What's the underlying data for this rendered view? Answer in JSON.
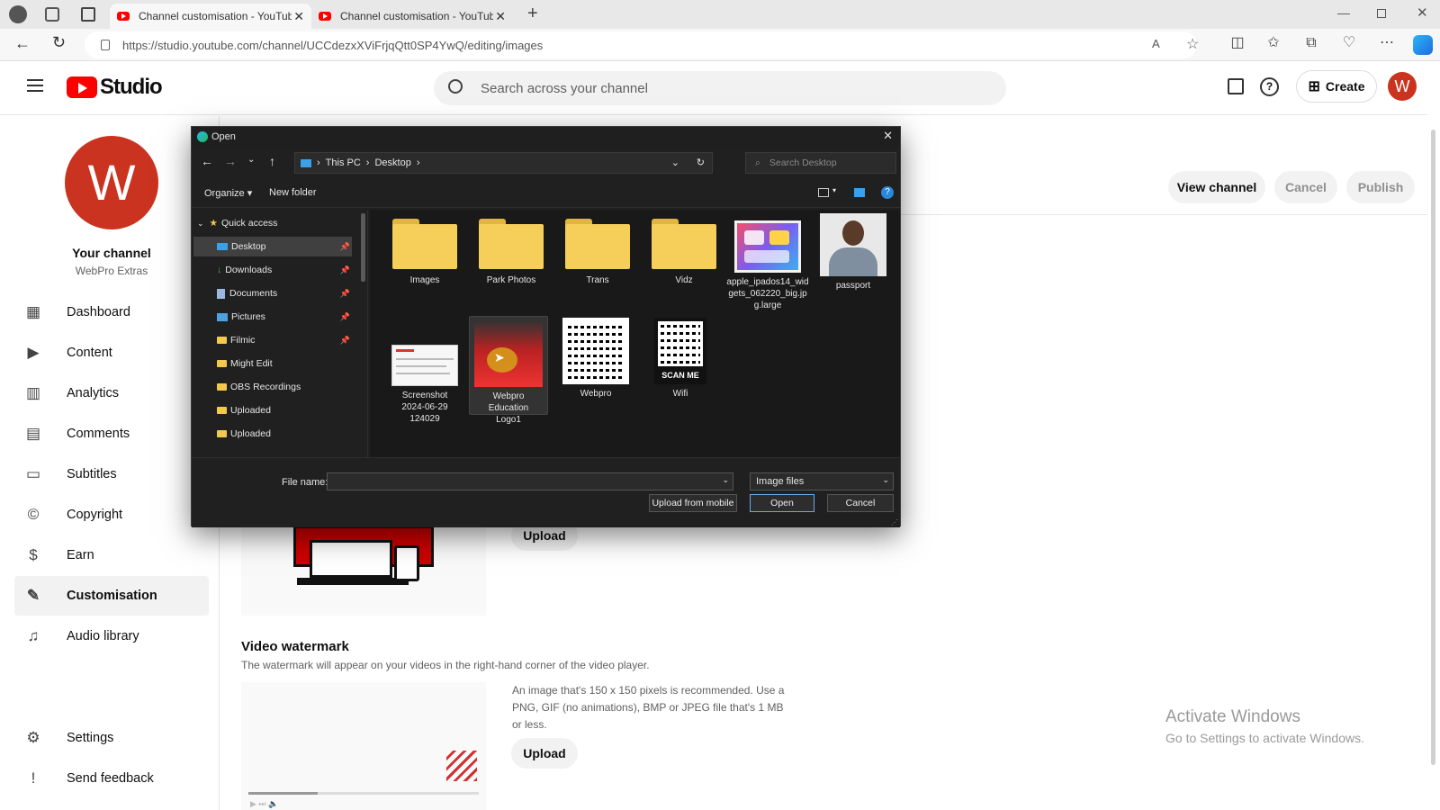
{
  "browser": {
    "tabs": [
      {
        "label": "Channel customisation - YouTube"
      },
      {
        "label": "Channel customisation - YouTube"
      }
    ],
    "url": "https://studio.youtube.com/channel/UCCdezxXViFrjqQtt0SP4YwQ/editing/images"
  },
  "header": {
    "logo_text": "Studio",
    "search_placeholder": "Search across your channel",
    "create_label": "Create",
    "avatar_letter": "W"
  },
  "sidebar": {
    "avatar_letter": "W",
    "channel_title": "Your channel",
    "channel_name": "WebPro Extras",
    "items": [
      {
        "label": "Dashboard",
        "icon": "dashboard-icon"
      },
      {
        "label": "Content",
        "icon": "content-icon"
      },
      {
        "label": "Analytics",
        "icon": "analytics-icon"
      },
      {
        "label": "Comments",
        "icon": "comments-icon"
      },
      {
        "label": "Subtitles",
        "icon": "subtitles-icon"
      },
      {
        "label": "Copyright",
        "icon": "copyright-icon"
      },
      {
        "label": "Earn",
        "icon": "earn-icon"
      },
      {
        "label": "Customisation",
        "icon": "customisation-icon"
      },
      {
        "label": "Audio library",
        "icon": "audio-library-icon"
      }
    ],
    "settings_label": "Settings",
    "feedback_label": "Send feedback"
  },
  "page": {
    "view_channel": "View channel",
    "cancel": "Cancel",
    "publish": "Publish",
    "upload_top": "Upload",
    "watermark_title": "Video watermark",
    "watermark_desc": "The watermark will appear on your videos in the right-hand corner of the video player.",
    "watermark_hint": "An image that's 150 x 150 pixels is recommended. Use a PNG, GIF (no animations), BMP or JPEG file that's 1 MB or less.",
    "upload_bottom": "Upload",
    "activate_title": "Activate Windows",
    "activate_sub": "Go to Settings to activate Windows."
  },
  "dialog": {
    "title": "Open",
    "crumb": [
      "This PC",
      "Desktop"
    ],
    "search_placeholder": "Search Desktop",
    "organize": "Organize",
    "new_folder": "New folder",
    "quick_access": "Quick access",
    "tree": [
      {
        "label": "Desktop",
        "pinned": true
      },
      {
        "label": "Downloads",
        "pinned": true
      },
      {
        "label": "Documents",
        "pinned": true
      },
      {
        "label": "Pictures",
        "pinned": true
      },
      {
        "label": "Filmic",
        "pinned": true
      },
      {
        "label": "Might Edit",
        "pinned": false
      },
      {
        "label": "OBS Recordings",
        "pinned": false
      },
      {
        "label": "Uploaded",
        "pinned": false
      },
      {
        "label": "Uploaded",
        "pinned": false
      }
    ],
    "files": [
      {
        "name": "Images",
        "kind": "folder"
      },
      {
        "name": "Park Photos",
        "kind": "folder"
      },
      {
        "name": "Trans",
        "kind": "folder"
      },
      {
        "name": "Vidz",
        "kind": "folder"
      },
      {
        "name": "apple_ipados14_widgets_062220_big.jpg.large",
        "kind": "image"
      },
      {
        "name": "passport",
        "kind": "image"
      },
      {
        "name": "Screenshot 2024-06-29 124029",
        "kind": "image"
      },
      {
        "name": "Webpro Education Logo1",
        "kind": "image"
      },
      {
        "name": "Webpro",
        "kind": "qr"
      },
      {
        "name": "Wifi",
        "kind": "qr"
      }
    ],
    "wifi_caption": "SCAN ME",
    "file_name_label": "File name:",
    "file_name_value": "",
    "file_type": "Image files",
    "upload_mobile": "Upload from mobile",
    "open": "Open",
    "cancel": "Cancel"
  }
}
